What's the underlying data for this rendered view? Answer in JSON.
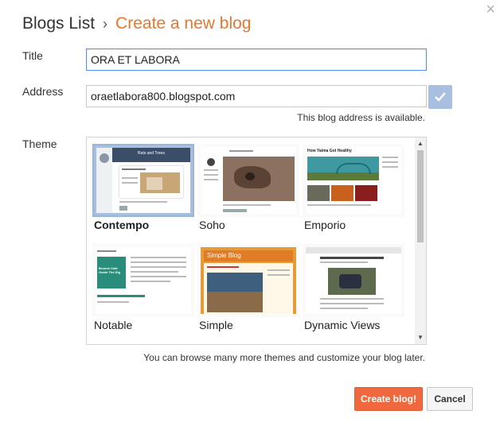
{
  "header": {
    "crumb": "Blogs List",
    "separator": "›",
    "current": "Create a new blog",
    "close_icon": "×"
  },
  "form": {
    "title_label": "Title",
    "title_value": "ORA ET LABORA",
    "address_label": "Address",
    "address_value": "oraetlabora800.blogspot.com",
    "address_status": "This blog address is available.",
    "theme_label": "Theme"
  },
  "themes": [
    {
      "name": "Contempo",
      "selected": true
    },
    {
      "name": "Soho",
      "selected": false
    },
    {
      "name": "Emporio",
      "selected": false
    },
    {
      "name": "Notable",
      "selected": false
    },
    {
      "name": "Simple",
      "selected": false
    },
    {
      "name": "Dynamic Views",
      "selected": false
    }
  ],
  "thumb_text": {
    "contempo_title": "Rats and Trees",
    "emporio_title": "How Yaima Got Healthy",
    "simple_title": "Simple Blog",
    "notable_heading": "Brunch Cafe Guide The Dig"
  },
  "footer": {
    "note": "You can browse many more themes and customize your blog later.",
    "create_label": "Create blog!",
    "cancel_label": "Cancel"
  },
  "colors": {
    "accent": "#e8762d",
    "primary_button": "#f0683e",
    "check_button": "#a8bfe0"
  }
}
